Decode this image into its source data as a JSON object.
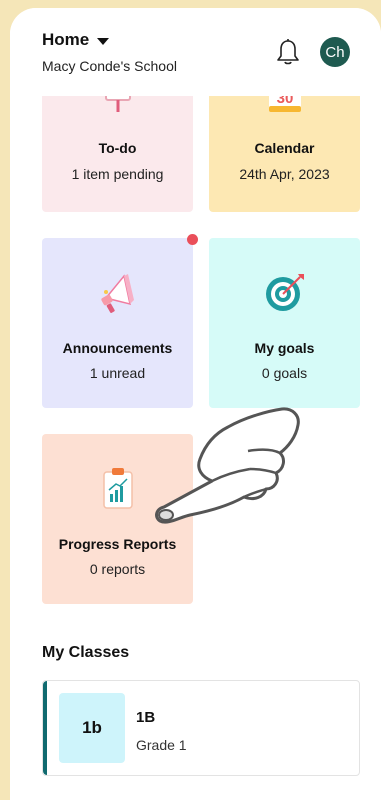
{
  "header": {
    "title": "Home",
    "school": "Macy Conde's School",
    "avatar_initials": "Ch"
  },
  "cards": {
    "todo": {
      "title": "To-do",
      "subtitle": "1 item pending",
      "bg": "#fbe9ec"
    },
    "calendar": {
      "title": "Calendar",
      "subtitle": "24th Apr, 2023",
      "icon_text": "30",
      "bg": "#fde8b3"
    },
    "announcements": {
      "title": "Announcements",
      "subtitle": "1 unread",
      "bg": "#e5e6fc",
      "has_notification_dot": true
    },
    "goals": {
      "title": "My goals",
      "subtitle": "0 goals",
      "bg": "#d6fbf8"
    },
    "progress": {
      "title": "Progress Reports",
      "subtitle": "0 reports",
      "bg": "#fde0d3"
    }
  },
  "classes_section": {
    "title": "My Classes",
    "items": [
      {
        "badge": "1b",
        "name": "1B",
        "grade": "Grade 1"
      }
    ]
  },
  "colors": {
    "page_bg": "#f5e6b8",
    "accent": "#106a6f",
    "avatar": "#1e5a50",
    "notification": "#ea4f5a"
  },
  "icons": [
    "bell-icon",
    "caret-down-icon",
    "easel-icon",
    "calendar-icon",
    "megaphone-icon",
    "target-icon",
    "report-clipboard-icon",
    "tap-hand-icon"
  ]
}
